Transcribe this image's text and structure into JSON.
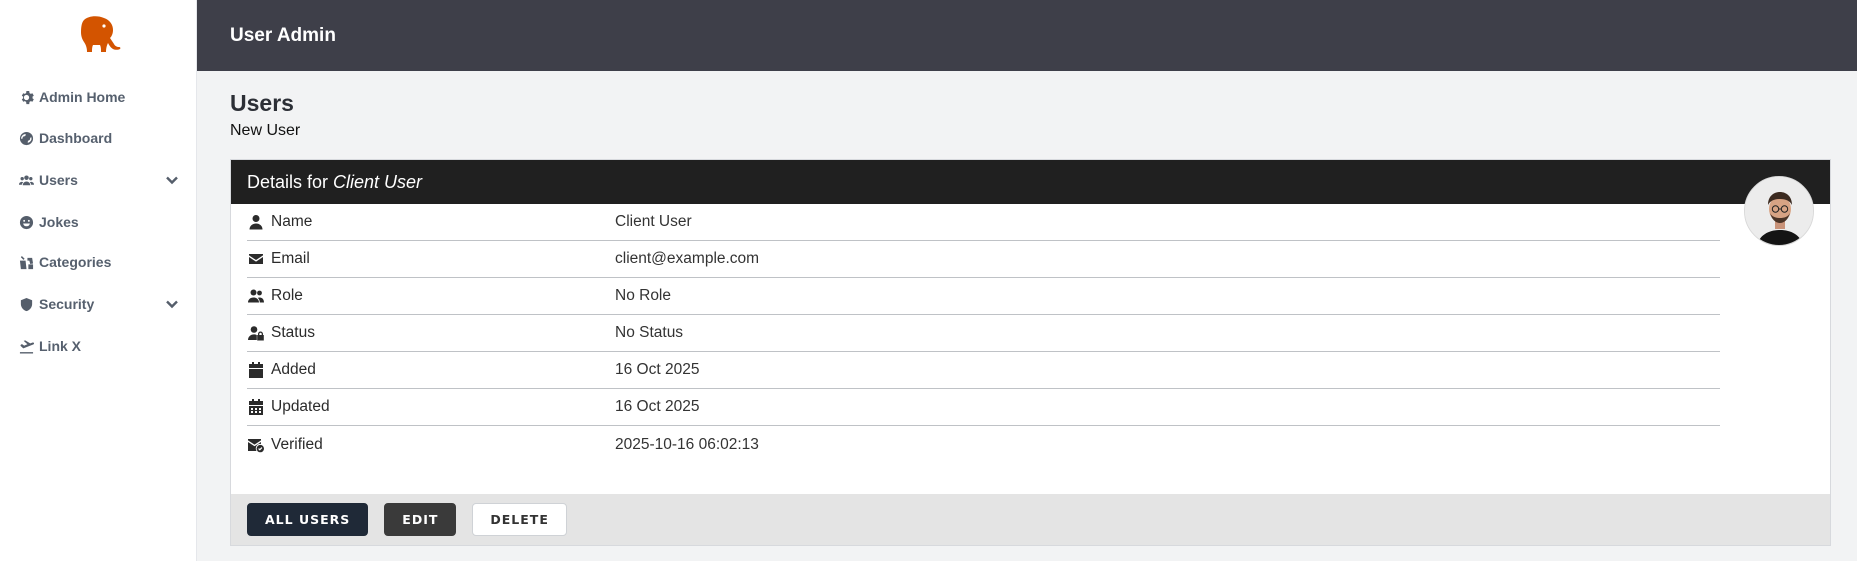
{
  "app": {
    "logo_icon": "elephant-icon",
    "brand_color": "#d35400"
  },
  "sidebar": {
    "items": [
      {
        "label": "Admin Home",
        "icon": "gear-icon"
      },
      {
        "label": "Dashboard",
        "icon": "globe-icon"
      },
      {
        "label": "Users",
        "icon": "users-icon",
        "expandable": true
      },
      {
        "label": "Jokes",
        "icon": "smile-icon"
      },
      {
        "label": "Categories",
        "icon": "categories-icon"
      },
      {
        "label": "Security",
        "icon": "shield-icon",
        "expandable": true
      },
      {
        "label": "Link X",
        "icon": "plane-icon"
      }
    ]
  },
  "header": {
    "title": "User Admin"
  },
  "page": {
    "title": "Users",
    "subtitle": "New User"
  },
  "card": {
    "heading_prefix": "Details for",
    "heading_name": "Client User",
    "rows": [
      {
        "label": "Name",
        "value": "Client User",
        "icon": "user-icon"
      },
      {
        "label": "Email",
        "value": "client@example.com",
        "icon": "envelope-icon"
      },
      {
        "label": "Role",
        "value": "No Role",
        "icon": "users-icon"
      },
      {
        "label": "Status",
        "value": "No Status",
        "icon": "user-lock-icon"
      },
      {
        "label": "Added",
        "value": "16 Oct 2025",
        "icon": "calendar-icon"
      },
      {
        "label": "Updated",
        "value": "16 Oct 2025",
        "icon": "calendar-days-icon"
      },
      {
        "label": "Verified",
        "value": "2025-10-16 06:02:13",
        "icon": "envelope-check-icon"
      }
    ],
    "avatar_icon": "user-avatar",
    "actions": {
      "all_users": "ALL USERS",
      "edit": "EDIT",
      "delete": "DELETE"
    }
  }
}
